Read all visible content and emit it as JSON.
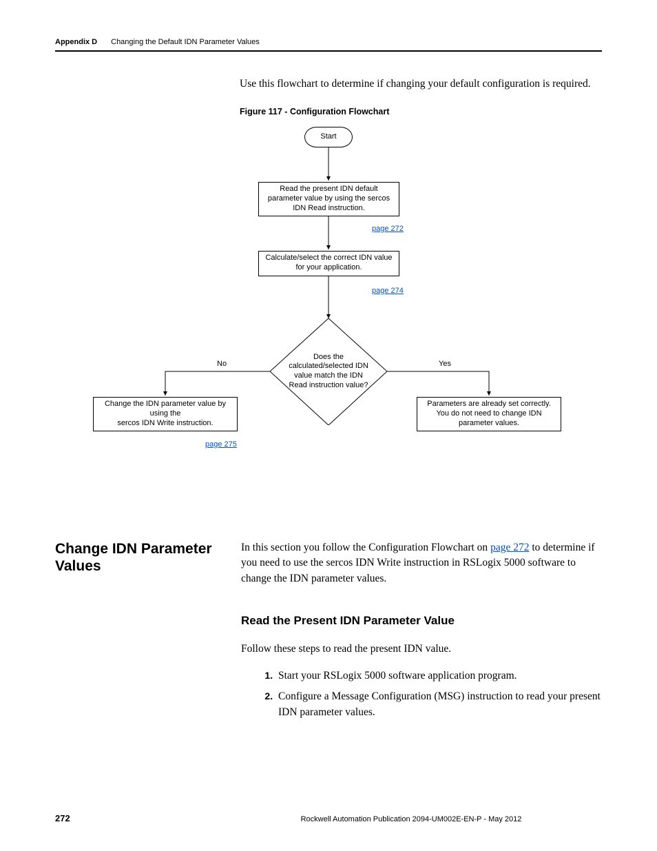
{
  "header": {
    "appendix": "Appendix D",
    "title": "Changing the Default IDN Parameter Values"
  },
  "intro": "Use this flowchart to determine if changing your default configuration is required.",
  "figure_caption": "Figure 117 - Configuration Flowchart",
  "flowchart": {
    "start": "Start",
    "step_read": "Read the present IDN default parameter value by using the sercos IDN Read instruction.",
    "link_read": "page 272",
    "step_calc": "Calculate/select the correct IDN value for your application.",
    "link_calc": "page 274",
    "decision": "Does the calculated/selected IDN value match the IDN Read instruction value?",
    "no": "No",
    "yes": "Yes",
    "left_box": "Change the IDN parameter value by using the\nsercos IDN Write instruction.",
    "link_left": "page 275",
    "right_box": "Parameters are already set correctly. You do not need to change IDN parameter values."
  },
  "section": {
    "heading": "Change IDN Parameter Values",
    "body_pre": "In this section you follow the Configuration Flowchart on ",
    "body_link": "page 272",
    "body_post": " to determine if you need to use the sercos IDN Write instruction in RSLogix 5000 software to change the IDN parameter values."
  },
  "subsection": {
    "heading": "Read the Present IDN Parameter Value",
    "lede": "Follow these steps to read the present IDN value.",
    "steps": [
      "Start your RSLogix 5000 software application program.",
      "Configure a Message Configuration (MSG) instruction to read your present IDN parameter values."
    ]
  },
  "footer": {
    "page": "272",
    "publication": "Rockwell Automation Publication 2094-UM002E-EN-P - May 2012"
  }
}
